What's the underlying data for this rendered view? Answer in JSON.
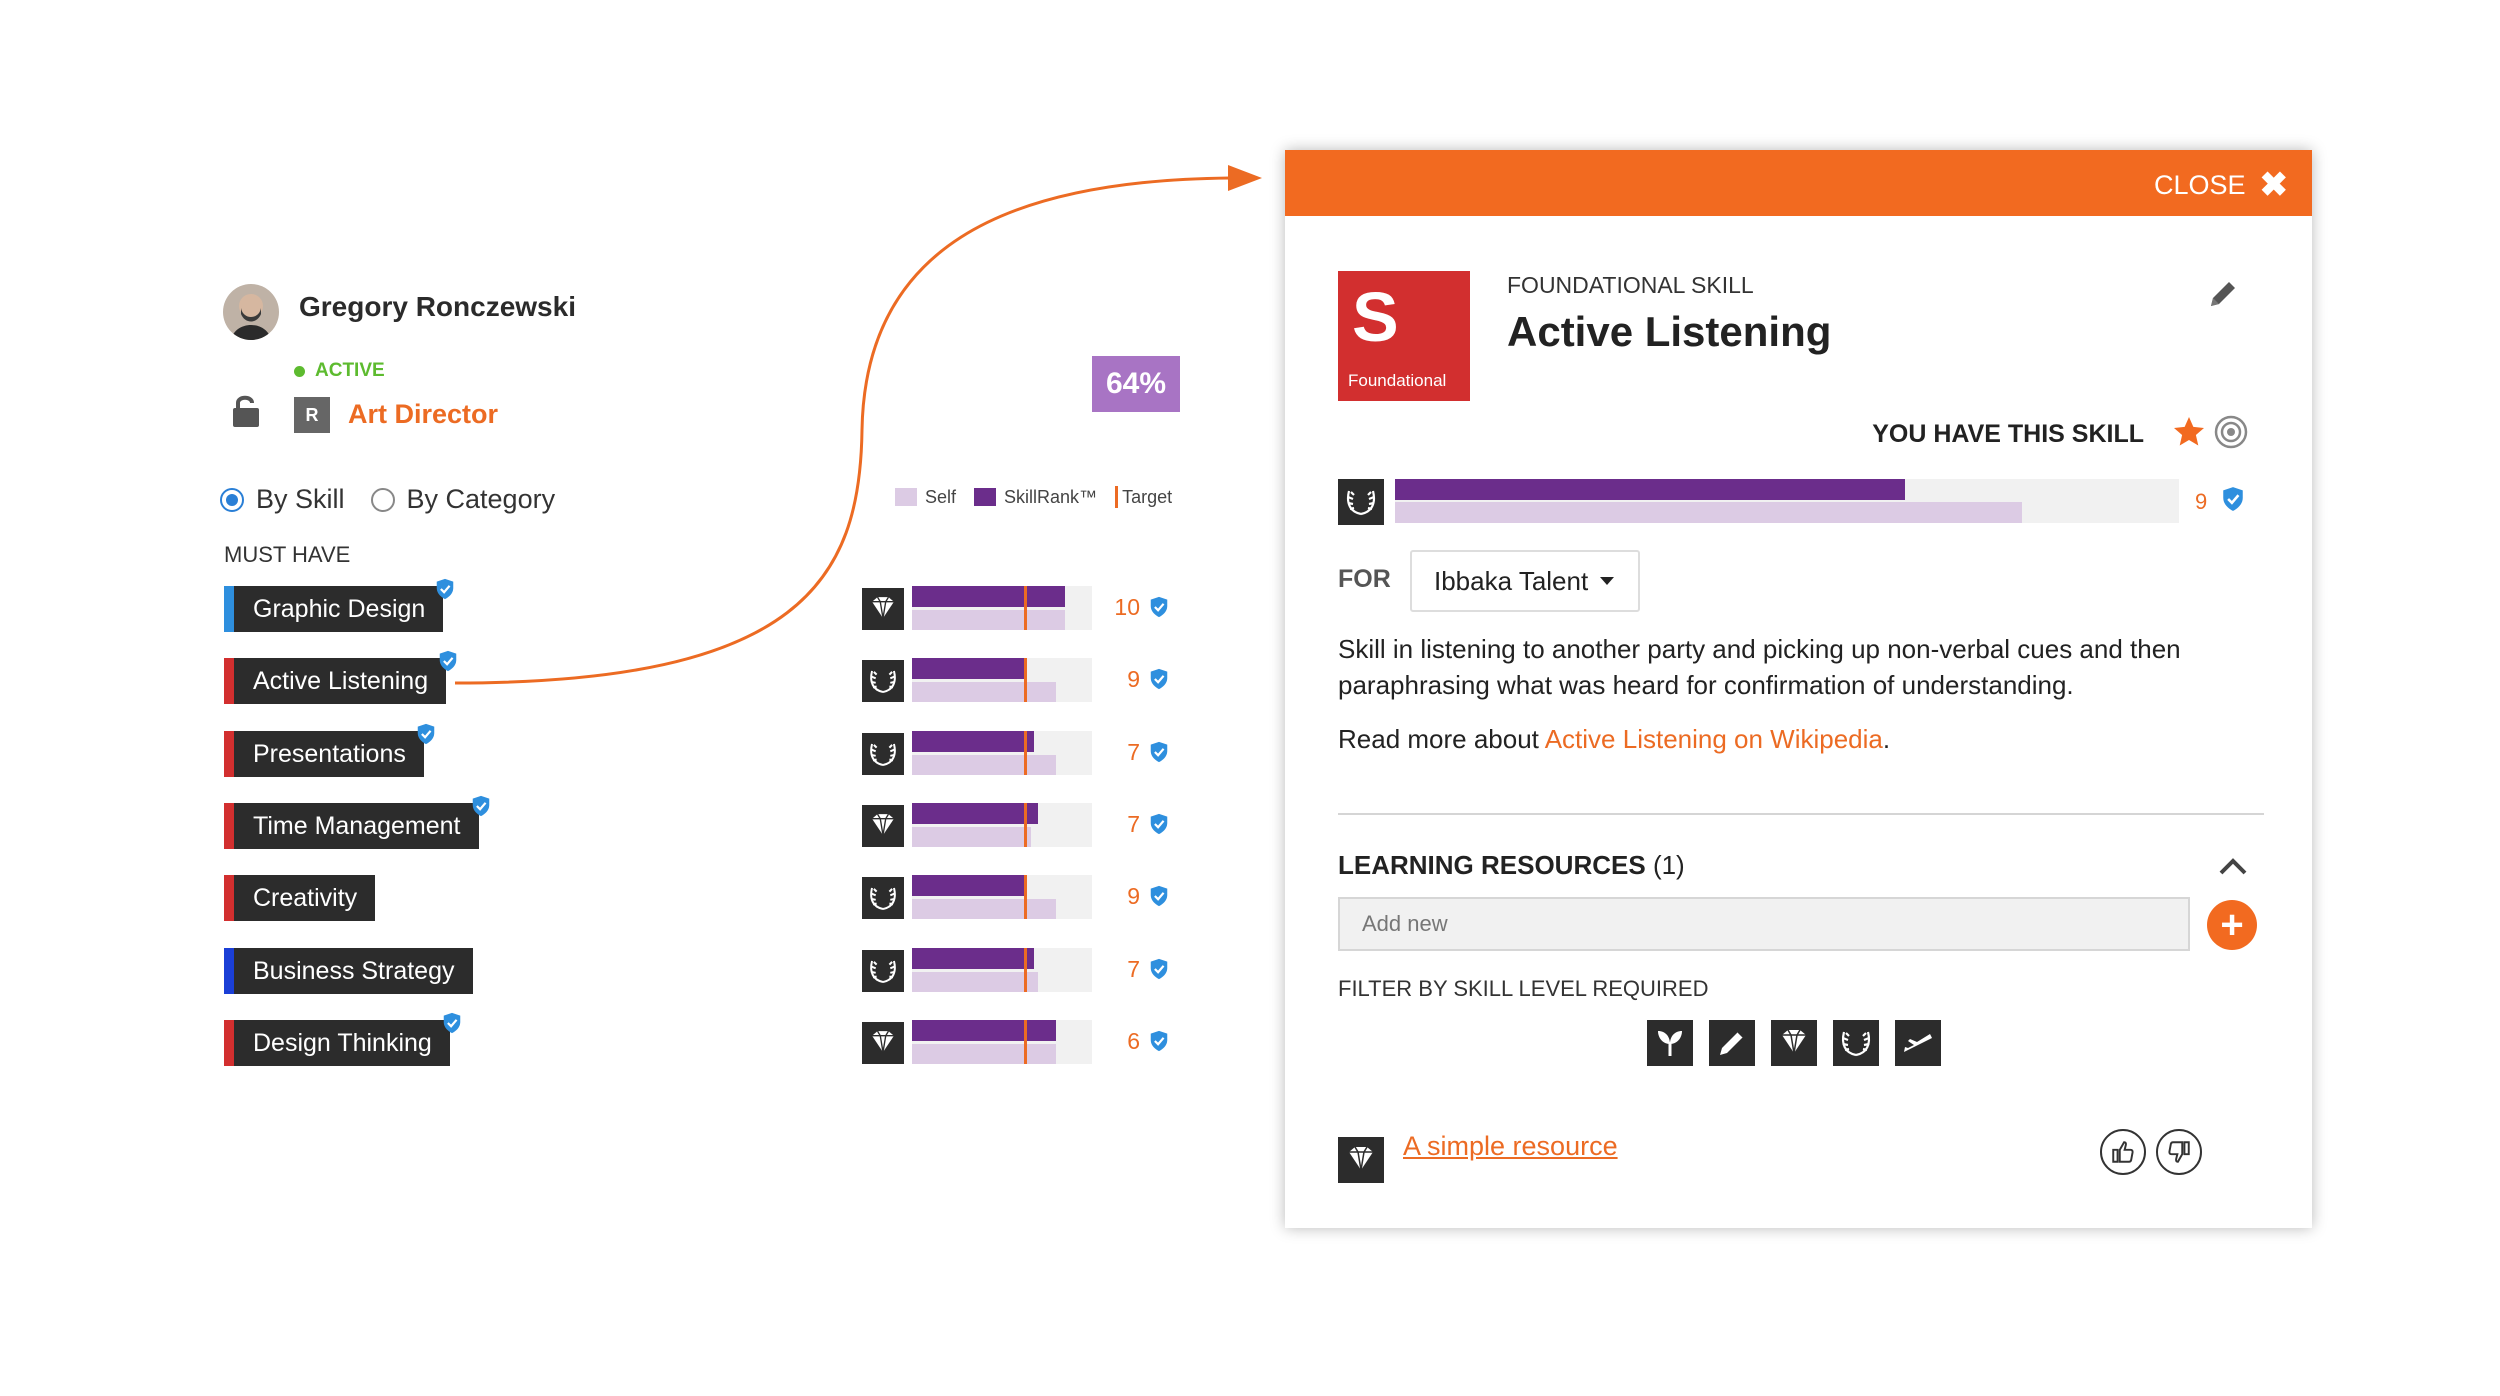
{
  "profile": {
    "name": "Gregory Ronczewski",
    "status": "ACTIVE",
    "role_badge": "R",
    "role": "Art Director"
  },
  "view_toggle": {
    "options": [
      {
        "label": "By Skill",
        "selected": true
      },
      {
        "label": "By Category",
        "selected": false
      }
    ]
  },
  "overall_percent": "64%",
  "legend": {
    "self": "Self",
    "skillrank": "SkillRank™",
    "target": "Target"
  },
  "section_label": "MUST HAVE",
  "skills": [
    {
      "name": "Graphic Design",
      "stripe": "#2e8fde",
      "verified": true,
      "icon": "diamond-icon",
      "rank": 0.85,
      "self": 0.85,
      "target": 0.62,
      "score": "10"
    },
    {
      "name": "Active Listening",
      "stripe": "#d22f2f",
      "verified": true,
      "icon": "laurel-icon",
      "rank": 0.63,
      "self": 0.8,
      "target": 0.62,
      "score": "9"
    },
    {
      "name": "Presentations",
      "stripe": "#d22f2f",
      "verified": true,
      "icon": "laurel-icon",
      "rank": 0.68,
      "self": 0.8,
      "target": 0.62,
      "score": "7"
    },
    {
      "name": "Time Management",
      "stripe": "#d22f2f",
      "verified": true,
      "icon": "diamond-icon",
      "rank": 0.7,
      "self": 0.66,
      "target": 0.62,
      "score": "7"
    },
    {
      "name": "Creativity",
      "stripe": "#d22f2f",
      "verified": false,
      "icon": "laurel-icon",
      "rank": 0.63,
      "self": 0.8,
      "target": 0.62,
      "score": "9"
    },
    {
      "name": "Business Strategy",
      "stripe": "#1b3fd6",
      "verified": false,
      "icon": "laurel-icon",
      "rank": 0.68,
      "self": 0.7,
      "target": 0.62,
      "score": "7"
    },
    {
      "name": "Design Thinking",
      "stripe": "#d22f2f",
      "verified": true,
      "icon": "diamond-icon",
      "rank": 0.8,
      "self": 0.8,
      "target": 0.62,
      "score": "6"
    }
  ],
  "modal": {
    "close_label": "CLOSE",
    "logo_letter": "S",
    "logo_sub": "Foundational",
    "kind": "FOUNDATIONAL SKILL",
    "title": "Active Listening",
    "have_label": "YOU HAVE THIS SKILL",
    "rank": 0.65,
    "self": 0.8,
    "score": "9",
    "for_label": "FOR",
    "for_value": "Ibbaka Talent",
    "description": "Skill in listening to another party and picking up non-verbal cues and then paraphrasing what was heard for confirmation of understanding.",
    "read_more_prefix": "Read more about ",
    "read_more_link": "Active Listening on Wikipedia",
    "read_more_suffix": ".",
    "lr_title": "LEARNING RESOURCES",
    "lr_count": "(1)",
    "add_placeholder": "Add new",
    "filter_label": "FILTER BY SKILL LEVEL REQUIRED",
    "filter_icons": [
      "sprout-icon",
      "pencil-icon",
      "diamond-icon",
      "laurel-icon",
      "plane-icon"
    ],
    "resource": {
      "icon": "diamond-icon",
      "label": "A simple resource"
    }
  },
  "colors": {
    "accent": "#f26a20",
    "skillrank": "#6b2d8b",
    "self": "#dccbe4",
    "badge": "#a874c4",
    "active": "#5dbb2f"
  }
}
